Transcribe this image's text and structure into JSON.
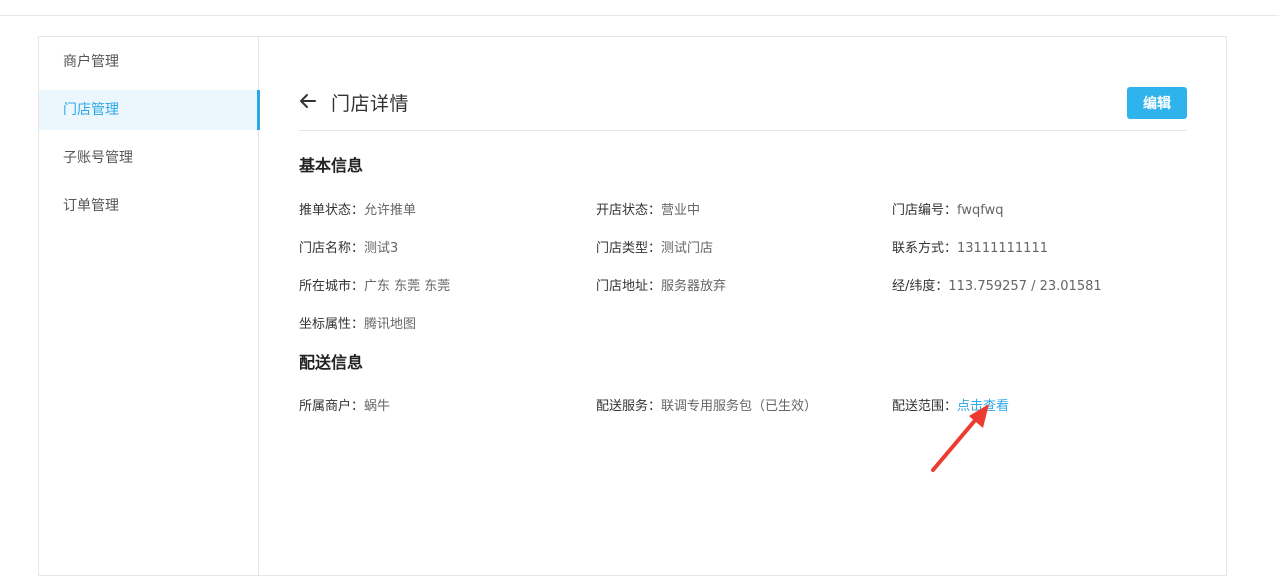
{
  "sidebar": {
    "items": [
      {
        "label": "商户管理"
      },
      {
        "label": "门店管理"
      },
      {
        "label": "子账号管理"
      },
      {
        "label": "订单管理"
      }
    ]
  },
  "header": {
    "title": "门店详情",
    "edit_label": "编辑"
  },
  "basic_info": {
    "title": "基本信息",
    "fields": [
      {
        "label": "推单状态：",
        "value": "允许推单"
      },
      {
        "label": "开店状态：",
        "value": "营业中"
      },
      {
        "label": "门店编号：",
        "value": "fwqfwq"
      },
      {
        "label": "门店名称：",
        "value": "测试3"
      },
      {
        "label": "门店类型：",
        "value": "测试门店"
      },
      {
        "label": "联系方式：",
        "value": "13111111111"
      },
      {
        "label": "所在城市：",
        "value": "广东 东莞 东莞"
      },
      {
        "label": "门店地址：",
        "value": "服务器放弃"
      },
      {
        "label": "经/纬度：",
        "value": "113.759257 / 23.01581"
      },
      {
        "label": "坐标属性：",
        "value": "腾讯地图"
      }
    ]
  },
  "delivery_info": {
    "title": "配送信息",
    "fields": [
      {
        "label": "所属商户：",
        "value": "蜗牛"
      },
      {
        "label": "配送服务：",
        "value": "联调专用服务包（已生效）"
      },
      {
        "label": "配送范围：",
        "value": "点击查看"
      }
    ]
  },
  "colors": {
    "accent": "#2ba8e8",
    "button": "#2eb3ec",
    "annotation_arrow": "#ee3b30"
  }
}
